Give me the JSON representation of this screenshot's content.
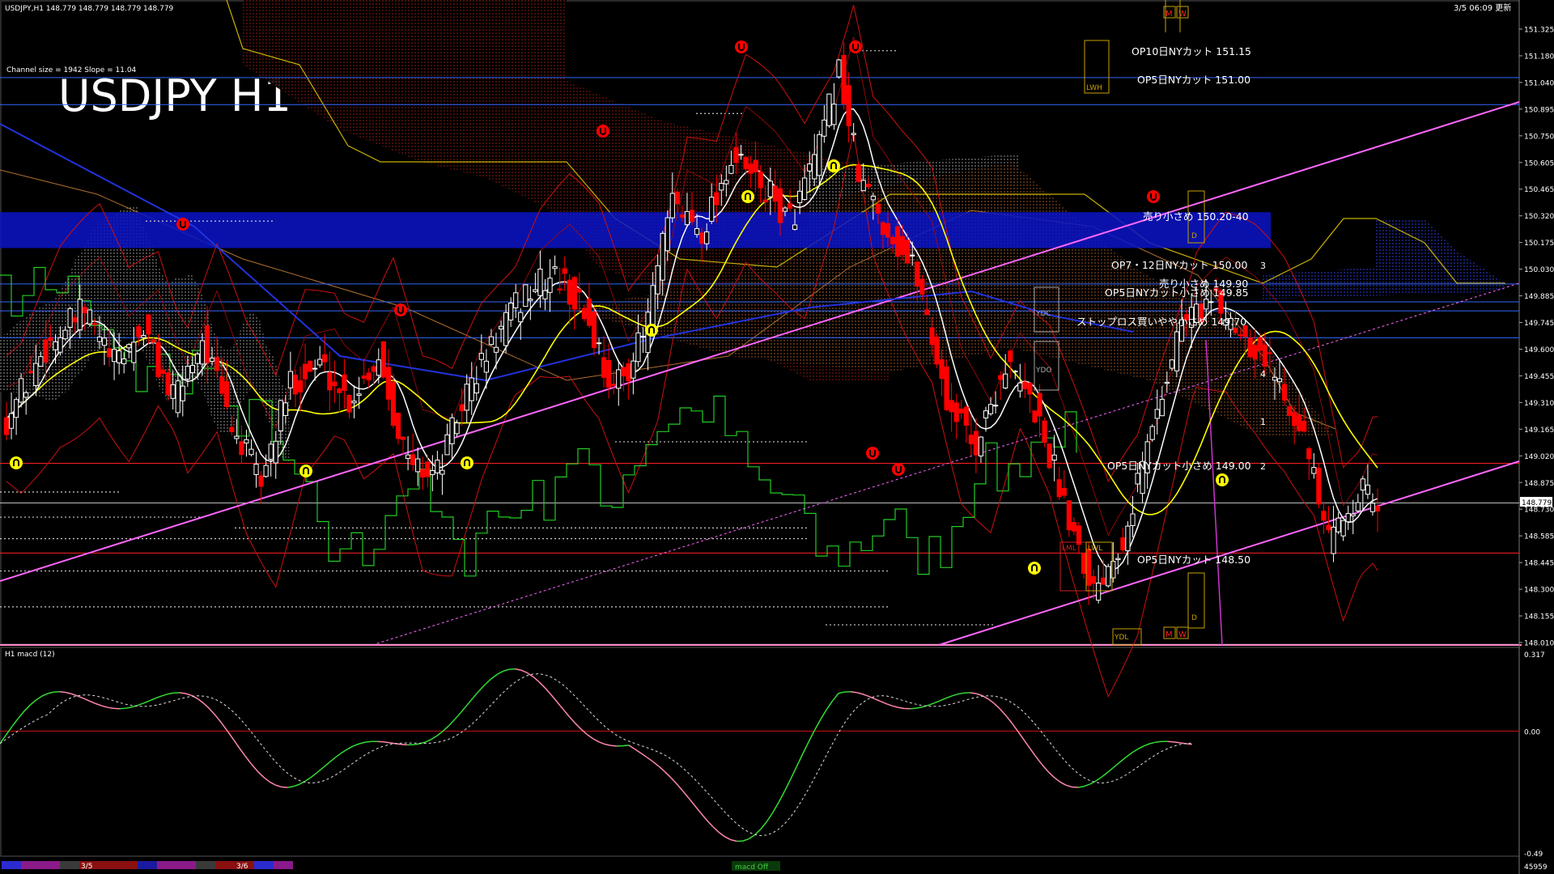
{
  "window": {
    "header": "USDJPY,H1  148.779 148.779 148.779 148.779",
    "datetime": "3/5 06:09 更新",
    "chart_title": "USDJPY H1",
    "channel_info": "Channel size = 1942 Slope = 11.04",
    "macd_label": "H1  macd (12)",
    "volume_readout": "45959"
  },
  "colors": {
    "up_candle": "#ffffff",
    "down_candle": "#ff0000",
    "ma_fast": "#ffffff",
    "ma_mid": "#ffff00",
    "ma_slow": "#2233dd",
    "trendline": "#ff66ff",
    "level_line": "#3366ff",
    "support_line": "#ff2020",
    "macd_up": "#33dd33",
    "macd_down": "#ff88aa",
    "zone_sell": "#0a14c8"
  },
  "chart_data": {
    "type": "candlestick",
    "symbol": "USDJPY",
    "timeframe": "H1",
    "ylim": [
      148.01,
      151.47
    ],
    "y_ticks": [
      "151.325",
      "151.180",
      "151.040",
      "150.895",
      "150.750",
      "150.605",
      "150.465",
      "150.320",
      "150.175",
      "150.030",
      "149.885",
      "149.745",
      "149.600",
      "149.455",
      "149.310",
      "149.165",
      "149.020",
      "148.875",
      "148.730",
      "148.585",
      "148.445",
      "148.300",
      "148.155",
      "148.010"
    ],
    "current_price": "148.779",
    "x_labels": [
      "3/5",
      "3/6"
    ],
    "levels": [
      {
        "label": "OP10日NYカット 151.15",
        "price": 151.15
      },
      {
        "label": "OP5日NYカット 151.00",
        "price": 151.0
      },
      {
        "label": "売り小さめ 150.20-40",
        "price": 150.3,
        "zone": [
          150.2,
          150.4
        ]
      },
      {
        "label": "OP7・12日NYカット 150.00",
        "price": 150.0
      },
      {
        "label": "売り小さめ 149.90",
        "price": 149.9
      },
      {
        "label": "OP5日NYカット小さめ 149.85",
        "price": 149.85
      },
      {
        "label": "ストップロス買いやや小さめ 149.70",
        "price": 149.7
      },
      {
        "label": "OP5日NYカット小さめ 149.00",
        "price": 149.0
      },
      {
        "label": "OP5日NYカット 148.50",
        "price": 148.5
      }
    ],
    "box_labels": [
      "LWH",
      "YDC",
      "YDO",
      "LML",
      "LWL",
      "YDL",
      "M",
      "W",
      "D"
    ],
    "wave_labels": [
      "3",
      "4",
      "1",
      "2"
    ],
    "macd": {
      "ylim": [
        -0.49,
        0.317
      ],
      "y_ticks": [
        "0.317",
        "0.00",
        "-0.49"
      ],
      "signal_label": "macd Off"
    }
  }
}
